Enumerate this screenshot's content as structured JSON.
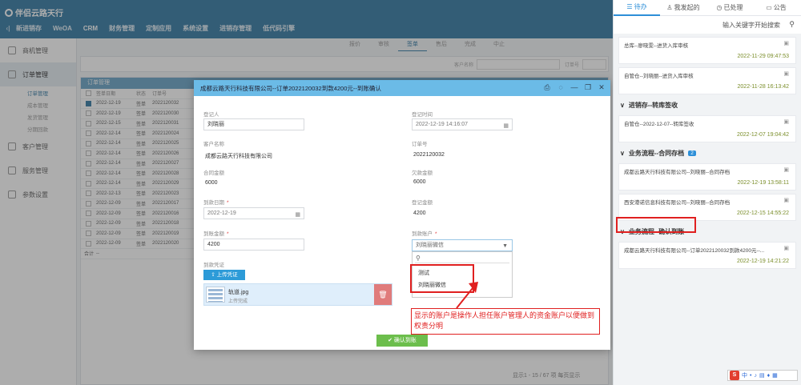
{
  "app": {
    "brand": "伴侣云路天行"
  },
  "module_nav": {
    "items": [
      "新进销存",
      "WeOA",
      "CRM",
      "财务管理",
      "定制应用",
      "系统设置",
      "进销存管理",
      "低代码引擎"
    ],
    "active": "CRM"
  },
  "left_nav": {
    "items": [
      {
        "label": "商机管理"
      },
      {
        "label": "订单管理"
      },
      {
        "label": "客户管理"
      },
      {
        "label": "服务管理"
      },
      {
        "label": "参数设置"
      }
    ],
    "sub_items": [
      "订单管理",
      "成本管理",
      "发货管理",
      "分期回款"
    ]
  },
  "status_tabs": [
    "报价",
    "审核",
    "签单",
    "售后",
    "完成",
    "中止"
  ],
  "filter": {
    "label1": "客户名称",
    "label2": "订单号"
  },
  "order_panel": {
    "title": "订单管理",
    "columns": [
      "签单日期",
      "状态",
      "订单号"
    ],
    "rows": [
      [
        "2022-12-19",
        "签单",
        "2022120032"
      ],
      [
        "2022-12-19",
        "签单",
        "2022120030"
      ],
      [
        "2022-12-15",
        "签单",
        "2022120031"
      ],
      [
        "2022-12-14",
        "签单",
        "2022120024"
      ],
      [
        "2022-12-14",
        "签单",
        "2022120025"
      ],
      [
        "2022-12-14",
        "签单",
        "2022120026"
      ],
      [
        "2022-12-14",
        "签单",
        "2022120027"
      ],
      [
        "2022-12-14",
        "签单",
        "2022120028"
      ],
      [
        "2022-12-14",
        "签单",
        "2022120029"
      ],
      [
        "2022-12-13",
        "签单",
        "2022120023"
      ],
      [
        "2022-12-09",
        "签单",
        "2022120017"
      ],
      [
        "2022-12-09",
        "签单",
        "2022120016"
      ],
      [
        "2022-12-09",
        "签单",
        "2022120018"
      ],
      [
        "2022-12-09",
        "签单",
        "2022120019"
      ],
      [
        "2022-12-09",
        "签单",
        "2022120020"
      ]
    ],
    "total_label": "合计",
    "total_dash": "--",
    "pager": "显示1 - 15 / 67 项  每页显示"
  },
  "dialog": {
    "title": "成都云路天行科技有限公司--订单2022120032到款4200元--到账确认",
    "fields": {
      "registrant_label": "登记人",
      "registrant": "刘晓丽",
      "reg_time_label": "登记时间",
      "reg_time": "2022-12-19 14:16:07",
      "customer_label": "客户名称",
      "customer": "成都云路天行科技有限公司",
      "order_no_label": "订单号",
      "order_no": "2022120032",
      "contract_label": "合同金额",
      "contract": "6000",
      "owed_label": "欠款金额",
      "owed": "6000",
      "arrival_date_label": "到款日期",
      "arrival_date": "2022-12-19",
      "reg_amount_label": "登记金额",
      "reg_amount": "4200",
      "arrival_amount_label": "到账金额",
      "arrival_amount": "4200",
      "account_label": "到款账户",
      "account": "刘晓丽微信",
      "voucher_label": "到款凭证"
    },
    "upload_label": "上传凭证",
    "file": {
      "name": "轨道.jpg",
      "status": "上传完成"
    },
    "dropdown_options": [
      "测试",
      "刘晓丽微信"
    ],
    "annotation": "显示的账户是操作人担任账户管理人的资金账户以便做到权责分明",
    "confirm_label": "确认到账"
  },
  "right_panel": {
    "tabs": [
      "待办",
      "我发起的",
      "已处理",
      "公告"
    ],
    "search_placeholder": "输入关键字开始搜索",
    "items_top": [
      {
        "text": "总库--廖晓雯--进货入库审核",
        "date": "2022-11-29 09:47:53"
      },
      {
        "text": "自管仓--刘晓丽--进货入库审核",
        "date": "2022-11-28 16:13:42"
      }
    ],
    "section1": {
      "title": "进销存--转库签收",
      "items": [
        {
          "text": "自管仓--2022-12-07--转库签收",
          "date": "2022-12-07 19:04:42"
        }
      ]
    },
    "section2": {
      "title": "业务流程--合同存档",
      "badge": "2",
      "items": [
        {
          "text": "成都云路天行科技有限公司--刘晓丽--合同存档",
          "date": "2022-12-19 13:58:11"
        },
        {
          "text": "西安港诺信息科技有限公司--刘晓丽--合同存档",
          "date": "2022-12-15 14:55:22"
        }
      ]
    },
    "section3": {
      "title": "业务流程--确认到账",
      "items": [
        {
          "text": "成都云路天行科技有限公司--订单2022120032到款4200元--...",
          "date": "2022-12-19 14:21:22"
        }
      ]
    }
  },
  "colors": {
    "topbar": "#3a7ea7",
    "dialog_header": "#6bbbe7",
    "accent": "#2d8fd8",
    "annotation": "#e02020",
    "confirm": "#6cbe4c"
  }
}
